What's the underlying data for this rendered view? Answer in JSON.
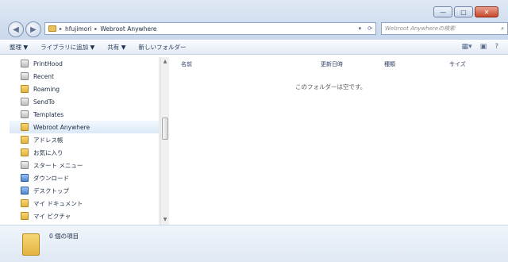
{
  "window": {
    "buttons": {
      "minimize": "—",
      "maximize": "□",
      "close": "✕"
    }
  },
  "nav": {
    "back": "◀",
    "forward": "▶",
    "breadcrumb": [
      "hfujimori",
      "Webroot Anywhere"
    ],
    "refresh_icon": "refresh-icon",
    "search_placeholder": "Webroot Anywhereの検索",
    "search_icon": "search-icon"
  },
  "toolbar": {
    "items": [
      "整理 ▼",
      "ライブラリに追加 ▼",
      "共有 ▼",
      "新しいフォルダー"
    ]
  },
  "sidebar": {
    "items": [
      {
        "label": "PrintHood",
        "icon": "sys"
      },
      {
        "label": "Recent",
        "icon": "sys"
      },
      {
        "label": "Roaming",
        "icon": "yel"
      },
      {
        "label": "SendTo",
        "icon": "sys"
      },
      {
        "label": "Templates",
        "icon": "sys"
      },
      {
        "label": "Webroot Anywhere",
        "icon": "yel",
        "selected": true
      },
      {
        "label": "アドレス帳",
        "icon": "yel"
      },
      {
        "label": "お気に入り",
        "icon": "yel"
      },
      {
        "label": "スタート メニュー",
        "icon": "sys"
      },
      {
        "label": "ダウンロード",
        "icon": "blu"
      },
      {
        "label": "デスクトップ",
        "icon": "blu"
      },
      {
        "label": "マイ ドキュメント",
        "icon": "yel"
      },
      {
        "label": "マイ ピクチャ",
        "icon": "yel"
      }
    ]
  },
  "columns": [
    "名前",
    "更新日時",
    "種類",
    "サイズ"
  ],
  "content": {
    "empty_message": "このフォルダーは空です。"
  },
  "status": {
    "count_label": "0 個の項目"
  }
}
